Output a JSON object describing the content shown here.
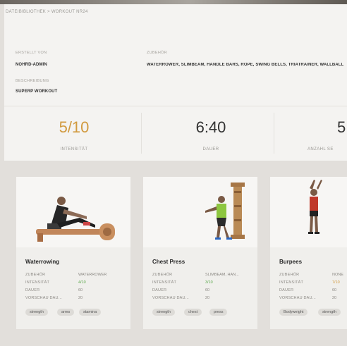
{
  "breadcrumb": {
    "root": "DATEIBIBLIOTHEK",
    "sep": ">",
    "current": "WORKOUT NR24"
  },
  "meta": {
    "created_by_label": "ERSTELLT VON",
    "created_by": "NOHRD-ADMIN",
    "description_label": "BESCHREIBUNG",
    "description": "SUPERP WORKOUT",
    "equipment_label": "ZUBEHÖR",
    "equipment": "WATERROWER, SLIMBEAM, HANDLE BARS, ROPE, SWING BELLS, TRIATRAINER, WALLBALL"
  },
  "stats": [
    {
      "value": "5/10",
      "label": "INTENSITÄT"
    },
    {
      "value": "6:40",
      "label": "DAUER"
    },
    {
      "value": "5",
      "label": "ANZAHL SE"
    }
  ],
  "colors": {
    "accent": "#d19a3f",
    "ok": "#5aa84a",
    "text": "#3a3a3a"
  },
  "exercises": [
    {
      "title": "Waterrowing",
      "rows": [
        {
          "label": "ZUBEHÖR",
          "value": "WATERROWER"
        },
        {
          "label": "INTENSITÄT",
          "value": "4/10"
        },
        {
          "label": "DAUER",
          "value": "60"
        },
        {
          "label": "VORSCHAU DAU...",
          "value": "20"
        }
      ],
      "tags": [
        "strength",
        "arms",
        "stamina"
      ]
    },
    {
      "title": "Chest Press",
      "rows": [
        {
          "label": "ZUBEHÖR",
          "value": "SLIMBEAM, HAN..."
        },
        {
          "label": "INTENSITÄT",
          "value": "3/10"
        },
        {
          "label": "DAUER",
          "value": "60"
        },
        {
          "label": "VORSCHAU DAU...",
          "value": "20"
        }
      ],
      "tags": [
        "strength",
        "chest",
        "press"
      ]
    },
    {
      "title": "Burpees",
      "rows": [
        {
          "label": "ZUBEHÖR",
          "value": "NONE"
        },
        {
          "label": "INTENSITÄT",
          "value": "7/10"
        },
        {
          "label": "DAUER",
          "value": "60"
        },
        {
          "label": "VORSCHAU DAU...",
          "value": "20"
        }
      ],
      "tags": [
        "Bodyweight",
        "strength"
      ]
    }
  ]
}
